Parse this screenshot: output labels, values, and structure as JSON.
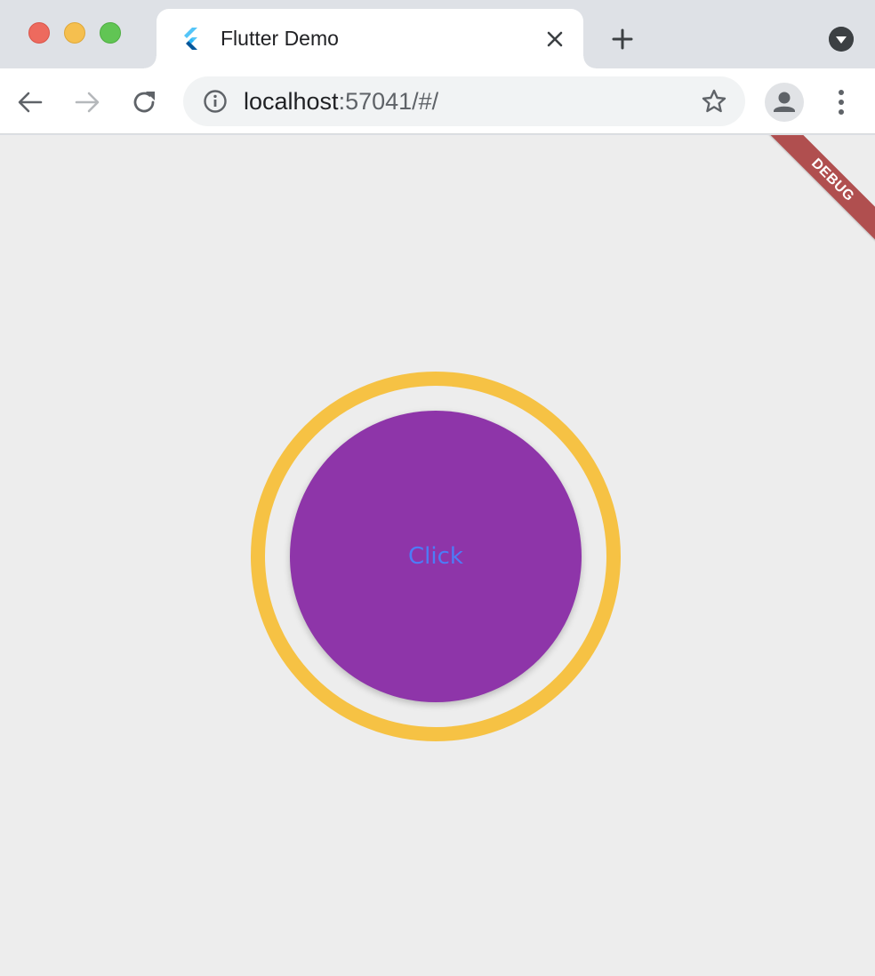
{
  "window": {
    "controls": {
      "close_color": "#ed6a5e",
      "minimize_color": "#f5bf4f",
      "zoom_color": "#61c554"
    }
  },
  "tab": {
    "title": "Flutter Demo",
    "favicon": "flutter-logo-icon"
  },
  "toolbar": {
    "url_host": "localhost",
    "url_rest": ":57041/#/"
  },
  "app": {
    "debug_banner": "DEBUG",
    "button_label": "Click",
    "colors": {
      "ring": "#f6c244",
      "button": "#8e35a9",
      "label": "#4d7cf7",
      "background": "#ededed"
    }
  }
}
